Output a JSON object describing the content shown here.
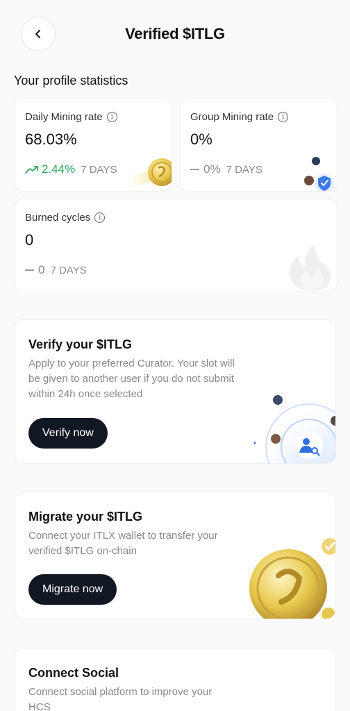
{
  "header": {
    "title": "Verified $ITLG"
  },
  "section_title": "Your profile statistics",
  "stats": {
    "daily_mining": {
      "label": "Daily Mining rate",
      "value": "68.03%",
      "change": "2.44%",
      "period": "7 DAYS"
    },
    "group_mining": {
      "label": "Group Mining rate",
      "value": "0%",
      "change": "0%",
      "period": "7 DAYS"
    },
    "burned_cycles": {
      "label": "Burned cycles",
      "value": "0",
      "change": "0",
      "period": "7 DAYS"
    }
  },
  "verify_card": {
    "title": "Verify your $ITLG",
    "description": "Apply to your preferred Curator. Your slot will be given to another user if you do not submit within 24h once selected",
    "button": "Verify now"
  },
  "migrate_card": {
    "title": "Migrate your $ITLG",
    "description": "Connect your ITLX wallet to transfer your verified $ITLG on-chain",
    "button": "Migrate now"
  },
  "social_card": {
    "title": "Connect Social",
    "description": "Connect social platform to improve your HCS"
  },
  "colors": {
    "accent_green": "#2ea85a",
    "button_dark": "#121823",
    "blue": "#2f6fe0",
    "gold": "#e2c24a"
  }
}
